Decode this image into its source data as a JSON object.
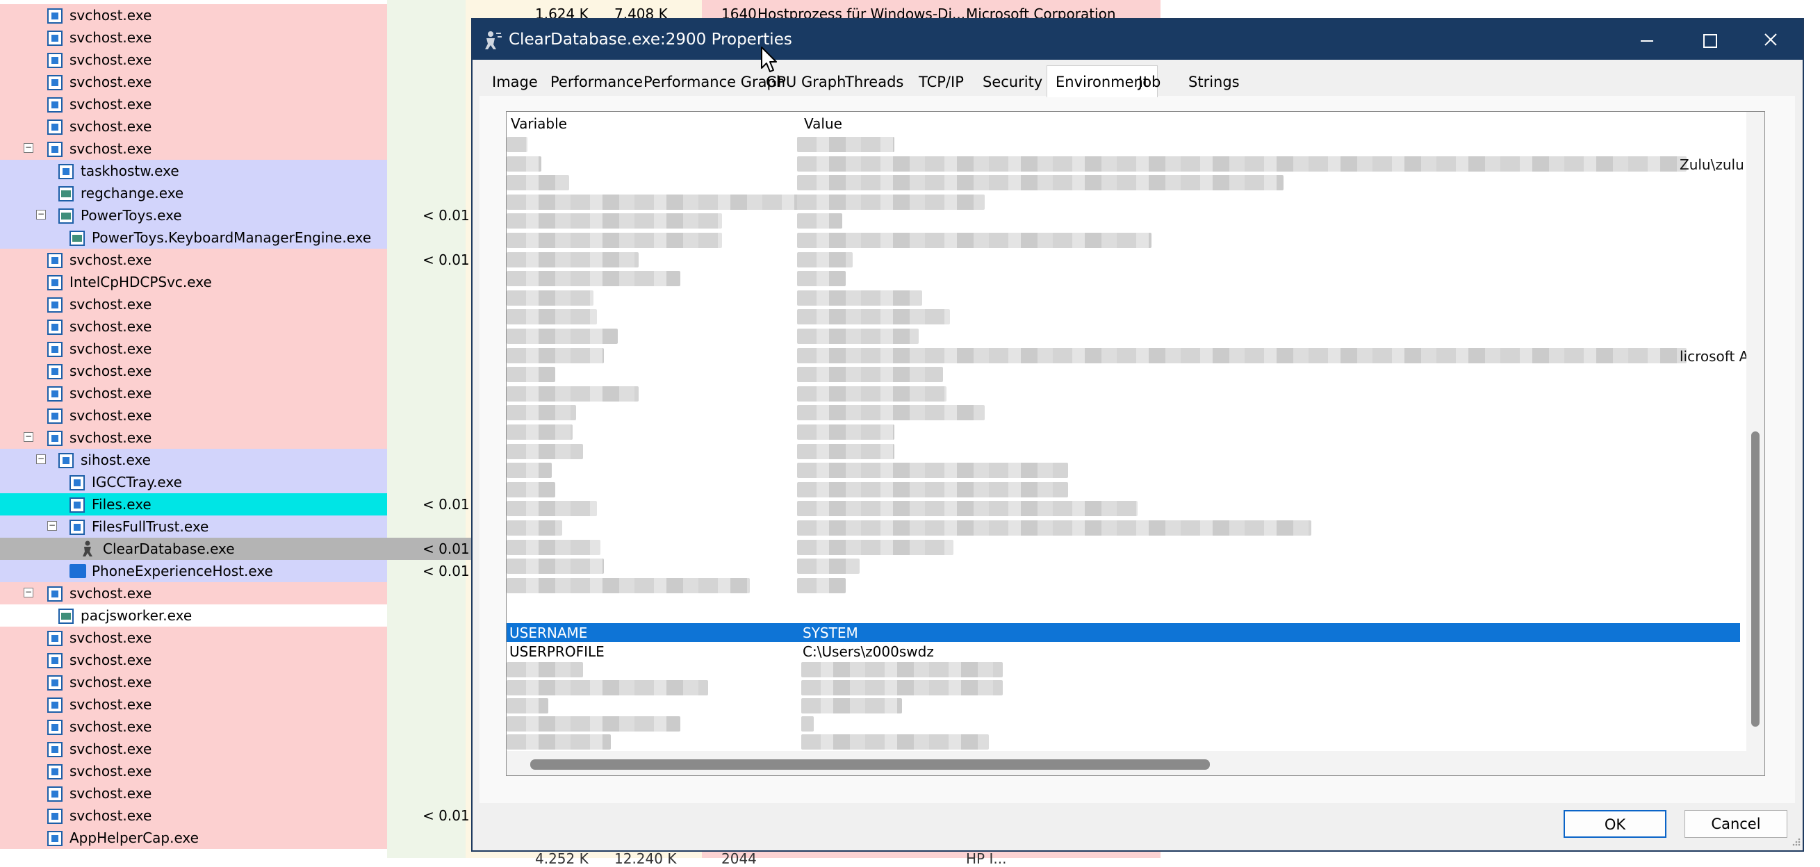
{
  "background": {
    "processes": [
      {
        "name": "svchost.exe",
        "indent": 0,
        "expander": "",
        "bg": "#fcd0d0"
      },
      {
        "name": "svchost.exe",
        "indent": 0,
        "expander": "",
        "bg": "#fcd0d0"
      },
      {
        "name": "svchost.exe",
        "indent": 0,
        "expander": "",
        "bg": "#fcd0d0"
      },
      {
        "name": "svchost.exe",
        "indent": 0,
        "expander": "",
        "bg": "#fcd0d0"
      },
      {
        "name": "svchost.exe",
        "indent": 0,
        "expander": "",
        "bg": "#fcd0d0"
      },
      {
        "name": "svchost.exe",
        "indent": 0,
        "expander": "",
        "bg": "#fcd0d0"
      },
      {
        "name": "svchost.exe",
        "indent": 0,
        "expander": "−",
        "bg": "#fcd0d0"
      },
      {
        "name": "taskhostw.exe",
        "indent": 1,
        "expander": "",
        "bg": "#d2d4fb"
      },
      {
        "name": "regchange.exe",
        "indent": 1,
        "expander": "",
        "bg": "#d2d4fb",
        "icon": "apm"
      },
      {
        "name": "PowerToys.exe",
        "indent": 1,
        "expander": "−",
        "bg": "#d2d4fb",
        "cpu": "< 0.01",
        "icon": "apm"
      },
      {
        "name": "PowerToys.KeyboardManagerEngine.exe",
        "indent": 2,
        "expander": "",
        "bg": "#d2d4fb",
        "icon": "apm"
      },
      {
        "name": "svchost.exe",
        "indent": 0,
        "expander": "",
        "bg": "#fcd0d0",
        "cpu": "< 0.01"
      },
      {
        "name": "IntelCpHDCPSvc.exe",
        "indent": 0,
        "expander": "",
        "bg": "#fcd0d0"
      },
      {
        "name": "svchost.exe",
        "indent": 0,
        "expander": "",
        "bg": "#fcd0d0"
      },
      {
        "name": "svchost.exe",
        "indent": 0,
        "expander": "",
        "bg": "#fcd0d0"
      },
      {
        "name": "svchost.exe",
        "indent": 0,
        "expander": "",
        "bg": "#fcd0d0"
      },
      {
        "name": "svchost.exe",
        "indent": 0,
        "expander": "",
        "bg": "#fcd0d0"
      },
      {
        "name": "svchost.exe",
        "indent": 0,
        "expander": "",
        "bg": "#fcd0d0"
      },
      {
        "name": "svchost.exe",
        "indent": 0,
        "expander": "",
        "bg": "#fcd0d0"
      },
      {
        "name": "svchost.exe",
        "indent": 0,
        "expander": "−",
        "bg": "#fcd0d0"
      },
      {
        "name": "sihost.exe",
        "indent": 1,
        "expander": "−",
        "bg": "#d2d4fb"
      },
      {
        "name": "IGCCTray.exe",
        "indent": 2,
        "expander": "",
        "bg": "#d2d4fb"
      },
      {
        "name": "Files.exe",
        "indent": 2,
        "expander": "",
        "bg": "#00e5e5",
        "cpu": "< 0.01"
      },
      {
        "name": "FilesFullTrust.exe",
        "indent": 2,
        "expander": "−",
        "bg": "#d2d4fb"
      },
      {
        "name": "ClearDatabase.exe",
        "indent": 3,
        "expander": "",
        "bg": "#b4b4b4",
        "cpu": "< 0.01",
        "icon": "person"
      },
      {
        "name": "PhoneExperienceHost.exe",
        "indent": 2,
        "expander": "",
        "bg": "#d2d4fb",
        "cpu": "< 0.01",
        "icon": "phone"
      },
      {
        "name": "svchost.exe",
        "indent": 0,
        "expander": "−",
        "bg": "#fcd0d0"
      },
      {
        "name": "pacjsworker.exe",
        "indent": 1,
        "expander": "",
        "bg": "#ffffff",
        "icon": "apm"
      },
      {
        "name": "svchost.exe",
        "indent": 0,
        "expander": "",
        "bg": "#fcd0d0"
      },
      {
        "name": "svchost.exe",
        "indent": 0,
        "expander": "",
        "bg": "#fcd0d0"
      },
      {
        "name": "svchost.exe",
        "indent": 0,
        "expander": "",
        "bg": "#fcd0d0"
      },
      {
        "name": "svchost.exe",
        "indent": 0,
        "expander": "",
        "bg": "#fcd0d0"
      },
      {
        "name": "svchost.exe",
        "indent": 0,
        "expander": "",
        "bg": "#fcd0d0"
      },
      {
        "name": "svchost.exe",
        "indent": 0,
        "expander": "",
        "bg": "#fcd0d0"
      },
      {
        "name": "svchost.exe",
        "indent": 0,
        "expander": "",
        "bg": "#fcd0d0"
      },
      {
        "name": "svchost.exe",
        "indent": 0,
        "expander": "",
        "bg": "#fcd0d0"
      },
      {
        "name": "svchost.exe",
        "indent": 0,
        "expander": "",
        "bg": "#fcd0d0",
        "cpu": "< 0.01"
      },
      {
        "name": "AppHelperCap.exe",
        "indent": 0,
        "expander": "",
        "bg": "#fcd0d0"
      }
    ],
    "top_row": {
      "private": "1.624 K",
      "working": "7.408 K",
      "pid": "1640",
      "description": "Hostprozess für Windows-Di...",
      "company": "Microsoft Corporation"
    },
    "bottom_row": {
      "private": "4.252 K",
      "working": "12.240 K",
      "pid": "2044",
      "company": "HP I..."
    }
  },
  "dialog": {
    "title": "ClearDatabase.exe:2900 Properties",
    "title_bar_color": "#193a63",
    "tabs": [
      "Image",
      "Performance",
      "Performance Graph",
      "GPU Graph",
      "Threads",
      "TCP/IP",
      "Security",
      "Environment",
      "Job",
      "Strings"
    ],
    "active_tab": "Environment",
    "columns": {
      "variable": "Variable",
      "value": "Value"
    },
    "right_edge_fragments": [
      "Zulu\\zulu",
      "licrosoft A"
    ],
    "selected_row": {
      "variable": "USERNAME",
      "value": "SYSTEM"
    },
    "row_after": {
      "variable": "USERPROFILE",
      "value": "C:\\Users\\z000swdz"
    },
    "selection_color": "#0e74d6",
    "buttons": {
      "ok": "OK",
      "cancel": "Cancel"
    }
  }
}
